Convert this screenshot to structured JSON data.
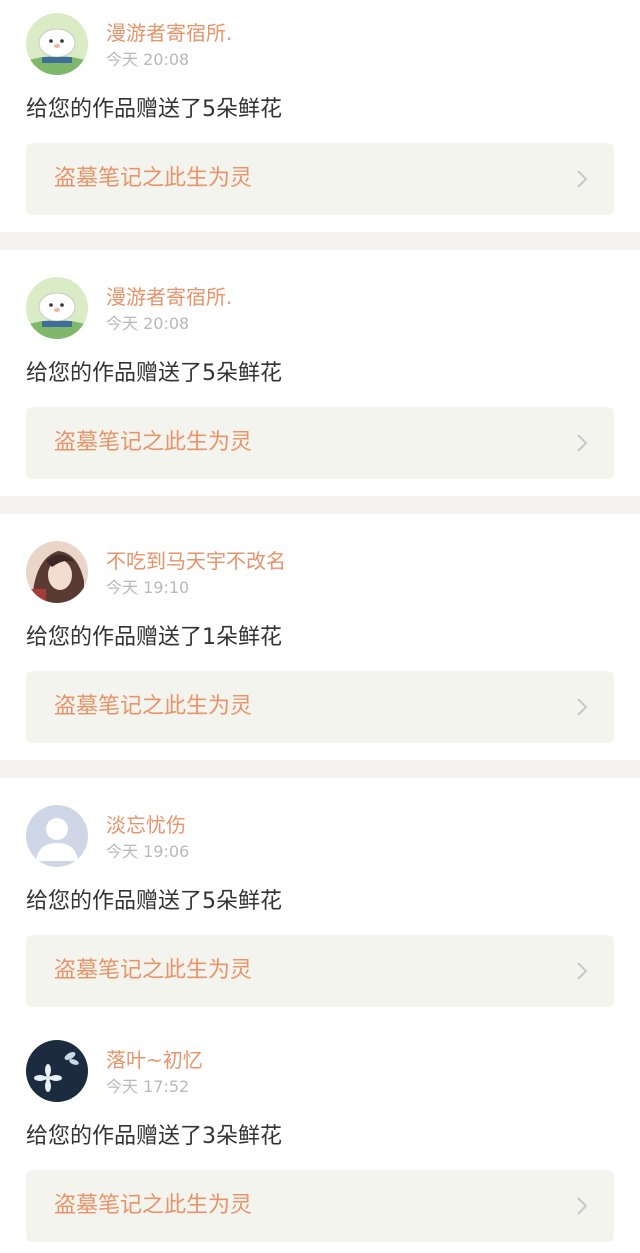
{
  "notifications": [
    {
      "user": "漫游者寄宿所.",
      "time": "今天 20:08",
      "message": "给您的作品赠送了5朵鲜花",
      "work_title": "盗墓笔记之此生为灵",
      "avatar": "sheep-avatar"
    },
    {
      "user": "漫游者寄宿所.",
      "time": "今天 20:08",
      "message": "给您的作品赠送了5朵鲜花",
      "work_title": "盗墓笔记之此生为灵",
      "avatar": "sheep-avatar"
    },
    {
      "user": "不吃到马天宇不改名",
      "time": "今天 19:10",
      "message": "给您的作品赠送了1朵鲜花",
      "work_title": "盗墓笔记之此生为灵",
      "avatar": "portrait-avatar"
    },
    {
      "user": "淡忘忧伤",
      "time": "今天 19:06",
      "message": "给您的作品赠送了5朵鲜花",
      "work_title": "盗墓笔记之此生为灵",
      "avatar": "default-user-avatar"
    },
    {
      "user": "落叶~初忆",
      "time": "今天 17:52",
      "message": "给您的作品赠送了3朵鲜花",
      "work_title": "盗墓笔记之此生为灵",
      "avatar": "flower-avatar"
    }
  ],
  "colors": {
    "accent": "#e8936a",
    "message_text": "#333333",
    "time_text": "#b9b9b9",
    "link_background": "#f4f4ee",
    "separator": "#f6f4f2"
  },
  "icons": {
    "chevron": "chevron-right-icon"
  }
}
